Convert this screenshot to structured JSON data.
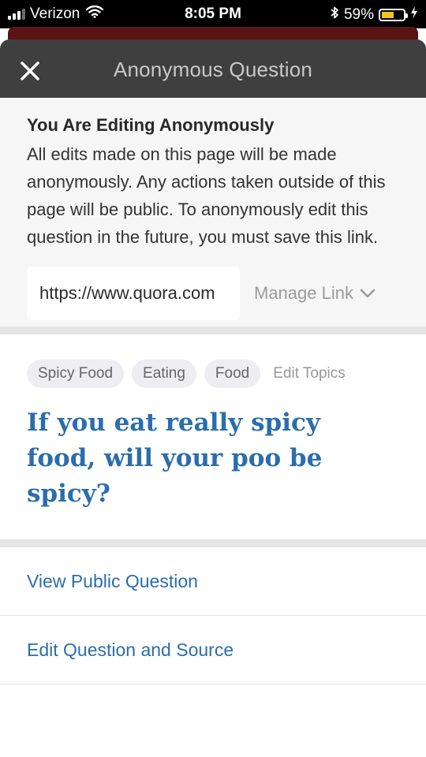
{
  "status_bar": {
    "carrier": "Verizon",
    "time": "8:05 PM",
    "battery_percent": "59%",
    "battery_level": 0.59,
    "battery_color": "#f5c518",
    "icons": [
      "signal-icon",
      "wifi-icon",
      "bluetooth-icon",
      "battery-icon",
      "charging-icon"
    ]
  },
  "header": {
    "title": "Anonymous Question",
    "close_icon": "close-icon"
  },
  "notice": {
    "title": "You Are Editing Anonymously",
    "body": "All edits made on this page will be made anonymously. Any actions taken outside of this page will be public. To anonymously edit this question in the future, you must save this link.",
    "link_value": "https://www.quora.com",
    "manage_link_label": "Manage Link"
  },
  "question": {
    "topics": [
      "Spicy Food",
      "Eating",
      "Food"
    ],
    "edit_topics_label": "Edit Topics",
    "title": "If you eat really spicy food, will your poo be spicy?"
  },
  "actions": {
    "view_public_label": "View Public Question",
    "edit_question_label": "Edit Question and Source"
  },
  "colors": {
    "header_bg": "#3f3f3f",
    "link_blue": "#2b6dad",
    "notice_bg": "#f6f6f6"
  }
}
